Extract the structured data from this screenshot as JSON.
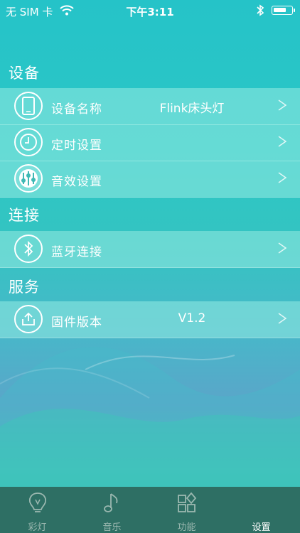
{
  "status_bar": {
    "carrier": "无 SIM 卡",
    "time": "下午3:11",
    "wifi_icon": "wifi-icon",
    "bluetooth_icon": "bluetooth-icon",
    "battery_level": 0.6
  },
  "sections": {
    "device": {
      "title": "设备",
      "rows": [
        {
          "label": "设备名称",
          "value": "Flink床头灯",
          "icon": "phone-icon"
        },
        {
          "label": "定时设置",
          "value": "",
          "icon": "clock-icon"
        },
        {
          "label": "音效设置",
          "value": "",
          "icon": "sound-effect-icon"
        }
      ]
    },
    "connection": {
      "title": "连接",
      "rows": [
        {
          "label": "蓝牙连接",
          "value": "",
          "icon": "bluetooth-icon"
        }
      ]
    },
    "service": {
      "title": "服务",
      "rows": [
        {
          "label": "固件版本",
          "value": "V1.2",
          "icon": "upload-icon"
        }
      ]
    }
  },
  "chevron_glyph": ">",
  "tabbar": {
    "tabs": [
      {
        "label": "彩灯",
        "icon": "bulb-icon",
        "active": false
      },
      {
        "label": "音乐",
        "icon": "music-note-icon",
        "active": false
      },
      {
        "label": "功能",
        "icon": "grid-icon",
        "active": false
      },
      {
        "label": "设置",
        "icon": "settings-icon",
        "active": true
      }
    ]
  },
  "colors": {
    "tabbar_bg": "#2e6f64",
    "tab_inactive": "#9bb8b0",
    "tab_active": "#ffffff"
  }
}
